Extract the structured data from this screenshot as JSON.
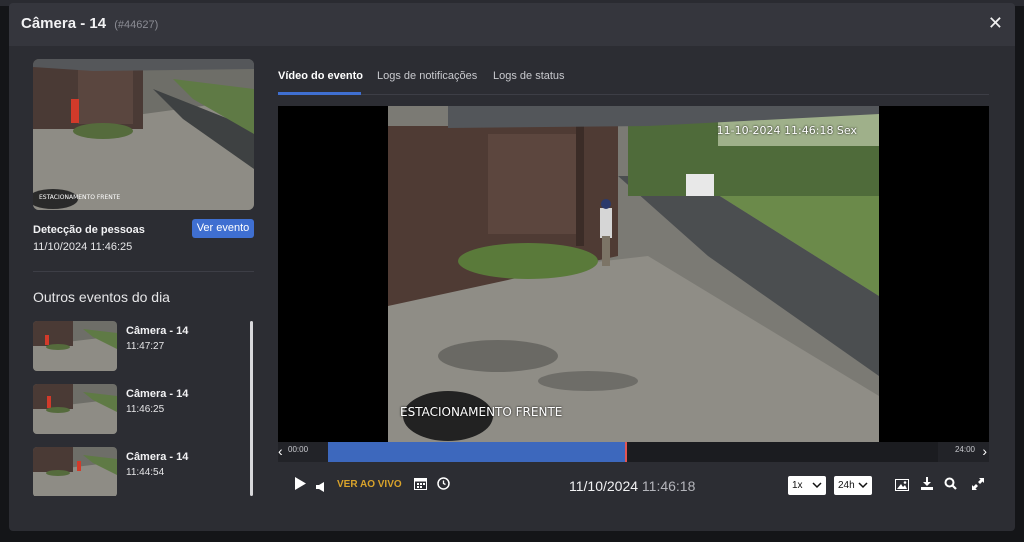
{
  "modal": {
    "title": "Câmera - 14",
    "id_label": "(#44627)",
    "close_glyph": "✕"
  },
  "event": {
    "title": "Detecção de pessoas",
    "datetime": "11/10/2024 11:46:25",
    "view_button": "Ver evento",
    "thumb_overlay": "ESTACIONAMENTO FRENTE"
  },
  "other_events": {
    "title": "Outros eventos do dia",
    "items": [
      {
        "camera": "Câmera - 14",
        "time": "11:47:27"
      },
      {
        "camera": "Câmera - 14",
        "time": "11:46:25"
      },
      {
        "camera": "Câmera - 14",
        "time": "11:44:54"
      }
    ]
  },
  "tabs": [
    {
      "label": "Vídeo do evento",
      "active": true
    },
    {
      "label": "Logs de notificações",
      "active": false
    },
    {
      "label": "Logs de status",
      "active": false
    }
  ],
  "video": {
    "overlay_timestamp": "11-10-2024 11:46:18 Sex",
    "overlay_name": "ESTACIONAMENTO FRENTE"
  },
  "timeline": {
    "start": "00:00",
    "end": "24:00",
    "progress_fraction": 0.49
  },
  "controls": {
    "live_label": "VER AO VIVO",
    "date": "11/10/2024",
    "time": "11:46:18",
    "speed": "1x",
    "range": "24h",
    "icons": [
      "play-icon",
      "volume-icon",
      "calendar-icon",
      "clock-icon",
      "image-icon",
      "download-icon",
      "search-icon",
      "fullscreen-icon"
    ]
  },
  "colors": {
    "accent": "#3f6fd1",
    "live": "#d9a32b",
    "timeline_fill": "#3d68bd",
    "playhead": "#e25555"
  }
}
